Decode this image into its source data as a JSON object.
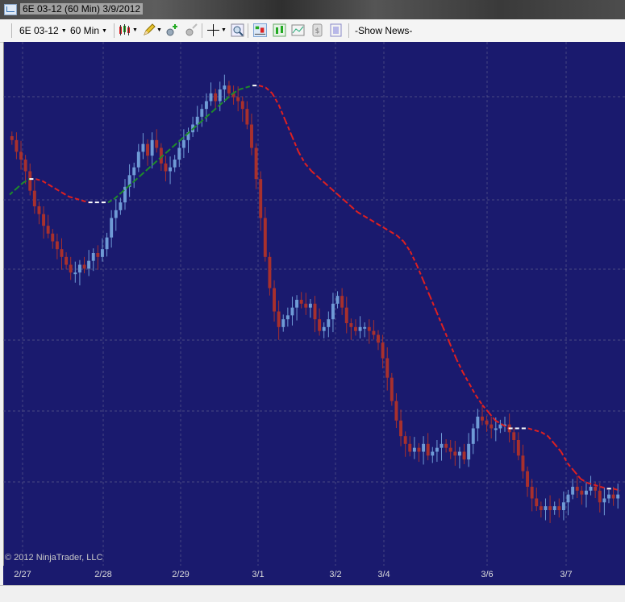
{
  "window": {
    "title": "6E 03-12 (60 Min)  3/9/2012"
  },
  "toolbar": {
    "instrument": "6E 03-12",
    "interval": "60 Min",
    "show_news": "-Show News-"
  },
  "copyright": "© 2012 NinjaTrader, LLC",
  "colors": {
    "background": "#1a1a6e",
    "up_bar": "#6f9bd6",
    "down_bar": "#a8302d",
    "ma_up": "#1e8c2a",
    "ma_down": "#e02020",
    "ma_flat": "#ffffff",
    "grid": "#5a5a8a"
  },
  "chart_data": {
    "type": "candlestick",
    "instrument": "6E 03-12",
    "interval": "60 Min",
    "x_tick_labels": [
      "2/27",
      "2/28",
      "2/29",
      "3/1",
      "3/2",
      "3/4",
      "3/6",
      "3/7"
    ],
    "y_axis": "not shown",
    "grid": true,
    "series": [
      {
        "type": "candlestick",
        "up_color": "#6f9bd6",
        "down_color": "#a8302d",
        "close": [
          0.86,
          0.83,
          0.81,
          0.78,
          0.73,
          0.69,
          0.67,
          0.64,
          0.62,
          0.6,
          0.58,
          0.56,
          0.54,
          0.52,
          0.52,
          0.54,
          0.53,
          0.55,
          0.57,
          0.56,
          0.58,
          0.61,
          0.66,
          0.68,
          0.7,
          0.74,
          0.77,
          0.79,
          0.83,
          0.85,
          0.82,
          0.86,
          0.84,
          0.8,
          0.78,
          0.79,
          0.81,
          0.84,
          0.86,
          0.88,
          0.9,
          0.92,
          0.94,
          0.96,
          0.98,
          0.96,
          0.99,
          1.0,
          0.98,
          0.97,
          0.96,
          0.94,
          0.9,
          0.84,
          0.76,
          0.66,
          0.56,
          0.48,
          0.42,
          0.38,
          0.4,
          0.41,
          0.43,
          0.45,
          0.44,
          0.43,
          0.44,
          0.4,
          0.37,
          0.38,
          0.4,
          0.44,
          0.46,
          0.43,
          0.39,
          0.38,
          0.37,
          0.38,
          0.38,
          0.37,
          0.36,
          0.34,
          0.3,
          0.25,
          0.19,
          0.14,
          0.1,
          0.08,
          0.06,
          0.07,
          0.06,
          0.08,
          0.05,
          0.06,
          0.07,
          0.08,
          0.07,
          0.06,
          0.05,
          0.06,
          0.04,
          0.08,
          0.12,
          0.15,
          0.14,
          0.13,
          0.12,
          0.12,
          0.13,
          0.13,
          0.11,
          0.09,
          0.05,
          0.01,
          -0.03,
          -0.06,
          -0.08,
          -0.09,
          -0.08,
          -0.09,
          -0.08,
          -0.09,
          -0.07,
          -0.05,
          -0.03,
          -0.04,
          -0.05,
          -0.04,
          -0.03,
          -0.04,
          -0.07,
          -0.06,
          -0.05,
          -0.06,
          -0.05
        ]
      },
      {
        "type": "line",
        "style": "dashed",
        "values": [
          0.72,
          0.735,
          0.75,
          0.76,
          0.76,
          0.755,
          0.745,
          0.735,
          0.725,
          0.715,
          0.71,
          0.705,
          0.7,
          0.7,
          0.7,
          0.7,
          0.71,
          0.725,
          0.74,
          0.755,
          0.77,
          0.785,
          0.8,
          0.815,
          0.83,
          0.845,
          0.86,
          0.875,
          0.89,
          0.905,
          0.92,
          0.935,
          0.95,
          0.965,
          0.98,
          0.99,
          0.995,
          1.0,
          1.0,
          0.995,
          0.98,
          0.95,
          0.91,
          0.87,
          0.83,
          0.8,
          0.78,
          0.765,
          0.75,
          0.735,
          0.72,
          0.705,
          0.69,
          0.675,
          0.665,
          0.655,
          0.645,
          0.635,
          0.625,
          0.615,
          0.6,
          0.575,
          0.54,
          0.5,
          0.46,
          0.42,
          0.38,
          0.34,
          0.3,
          0.265,
          0.235,
          0.205,
          0.18,
          0.16,
          0.14,
          0.13,
          0.12,
          0.12,
          0.12,
          0.12,
          0.115,
          0.11,
          0.1,
          0.08,
          0.06,
          0.03,
          0.01,
          -0.01,
          -0.02,
          -0.025,
          -0.03,
          -0.035,
          -0.035,
          -0.04
        ]
      }
    ]
  }
}
